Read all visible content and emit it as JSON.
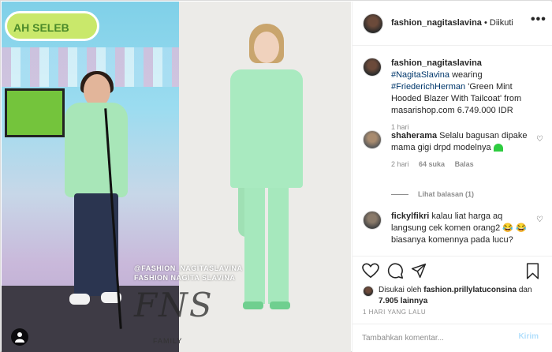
{
  "media": {
    "stage_banner": "AH SELEB",
    "watermark_lines": [
      "@FASHION_NAGITASLAVINA",
      "FASHION NAGITA SLAVINA"
    ],
    "watermark_logo": "FNS",
    "watermark_family": "FAMILY"
  },
  "header": {
    "username": "fashion_nagitaslavina",
    "follow_status": "• Diikuti",
    "more_icon": "more-horizontal-icon"
  },
  "caption": {
    "username": "fashion_nagitaslavina",
    "hashtag1": "#NagitaSlavina",
    "text1": "wearing",
    "hashtag2": "#FriederichHerman",
    "text2": "'Green Mint Hooded Blazer With Tailcoat' from masarishop.com 6.749.000 IDR",
    "time": "1 hari"
  },
  "comments": [
    {
      "username": "shaherama",
      "text": "Selalu bagusan dipake mama gigi drpd modelnya",
      "time": "2 hari",
      "likes": "64 suka",
      "reply": "Balas",
      "view_replies": "Lihat balasan (1)"
    },
    {
      "username": "fickylfikri",
      "text": "kalau liat harga aq langsung cek komen orang2",
      "text_continued": "biasanya komennya pada lucu?"
    }
  ],
  "actions": {
    "like_icon": "heart-icon",
    "comment_icon": "comment-icon",
    "share_icon": "share-icon",
    "save_icon": "bookmark-icon"
  },
  "likes": {
    "prefix": "Disukai oleh",
    "user": "fashion.prillylatuconsina",
    "suffix": "dan",
    "others": "7.905 lainnya"
  },
  "post_date": "1 HARI YANG LALU",
  "add_comment": {
    "placeholder": "Tambahkan komentar...",
    "post_label": "Kirim"
  },
  "colors": {
    "link": "#00376b",
    "post_button_disabled": "#b2dffc",
    "emoji_heart": "#2ecc40"
  }
}
